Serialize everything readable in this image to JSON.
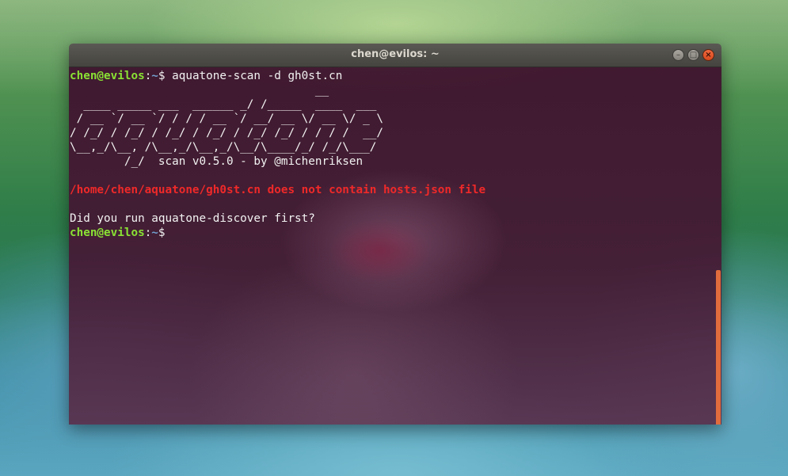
{
  "window": {
    "title": "chen@evilos: ~",
    "controls": {
      "minimize": "–",
      "maximize": "□",
      "close": "×"
    }
  },
  "terminal": {
    "prompt1": {
      "user_host": "chen@evilos",
      "sep": ":",
      "path": "~",
      "symbol": "$",
      "command": " aquatone-scan -d gh0st.cn"
    },
    "banner": [
      "                                    __",
      "  ____ _____ ___  ______ _/ /_____  ____  ___",
      " / __ `/ __ `/ / / / __ `/ __/ __ \\/ __ \\/ _ \\",
      "/ /_/ / /_/ / /_/ / /_/ / /_/ /_/ / / / /  __/",
      "\\__,_/\\__, /\\__,_/\\__,_/\\__/\\____/_/ /_/\\___/",
      "        /_/  scan v0.5.0 - by @michenriksen"
    ],
    "error": "/home/chen/aquatone/gh0st.cn does not contain hosts.json file",
    "question": "Did you run aquatone-discover first?",
    "prompt2": {
      "user_host": "chen@evilos",
      "sep": ":",
      "path": "~",
      "symbol": "$"
    }
  },
  "colors": {
    "prompt_user": "#8ae234",
    "prompt_path": "#729fcf",
    "error": "#ef2929",
    "scrollbar": "#e06b3c"
  }
}
